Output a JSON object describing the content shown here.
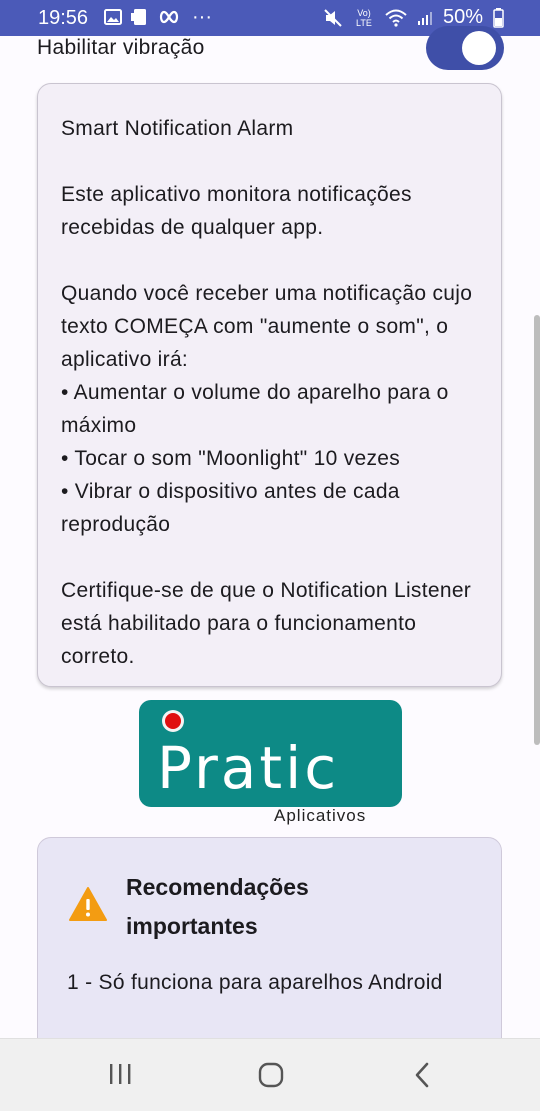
{
  "status_bar": {
    "time": "19:56",
    "battery": "50%",
    "notification_icons": [
      "image-icon",
      "cast-icon",
      "infinity-icon",
      "more-icon"
    ],
    "more_label": "···",
    "volte_label": "Vo) LTE"
  },
  "settings": {
    "vibration_label": "Habilitar vibração",
    "vibration_enabled": true
  },
  "info_card": {
    "title": "Smart Notification Alarm",
    "para1": "Este aplicativo monitora notificações recebidas de qualquer app.",
    "para2": "Quando você receber uma notificação cujo texto COMEÇA com \"aumente o som\", o aplicativo irá:",
    "bullet1": "• Aumentar o volume do aparelho para o máximo",
    "bullet2": "• Tocar o som \"Moonlight\" 10 vezes",
    "bullet3": "• Vibrar o dispositivo antes de cada reprodução",
    "para3": "Certifique-se de que o Notification Listener está habilitado para o funcionamento correto."
  },
  "logo": {
    "word": "Pratic",
    "subtitle": "Aplicativos"
  },
  "recommendations": {
    "title": "Recomendações importantes",
    "item1": "1 - Só funciona para aparelhos Android"
  },
  "colors": {
    "accent": "#3f4fa8",
    "logo_teal": "#0d8a86",
    "warning": "#f39c12"
  }
}
